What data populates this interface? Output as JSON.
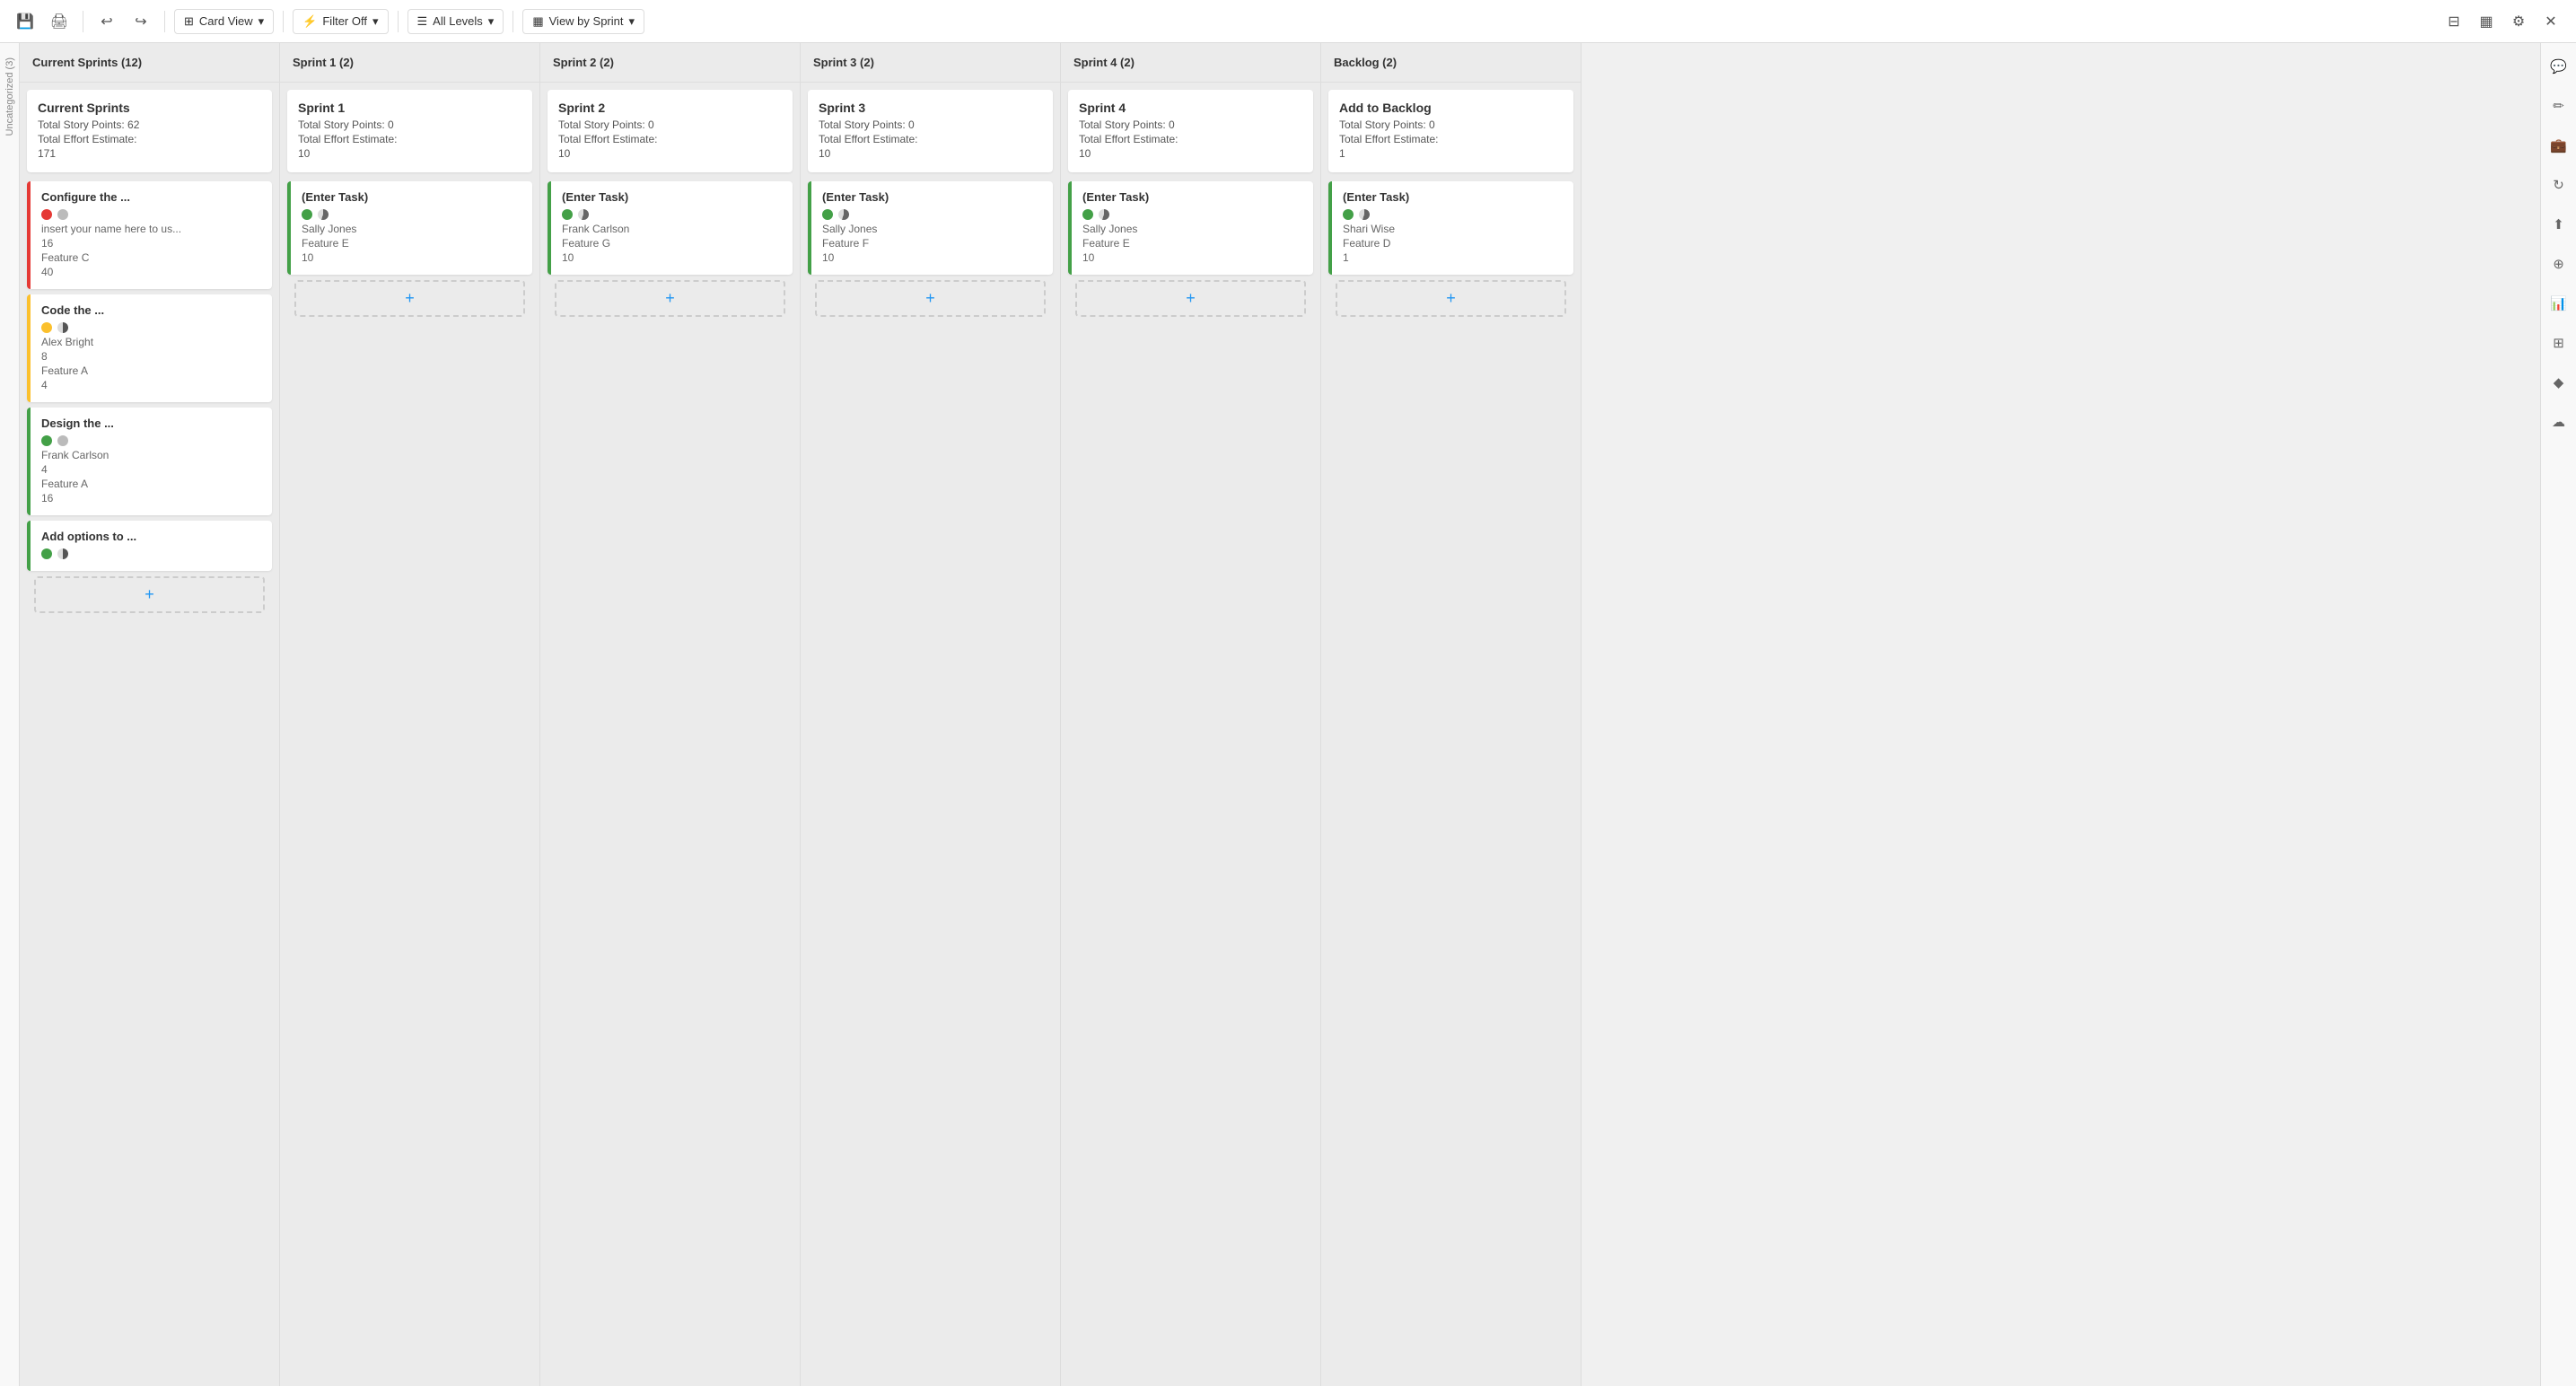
{
  "toolbar": {
    "save_icon": "💾",
    "print_icon": "🖨",
    "undo_icon": "↩",
    "redo_icon": "↪",
    "card_view_label": "Card View",
    "filter_label": "Filter Off",
    "levels_label": "All Levels",
    "view_by_sprint_label": "View by Sprint",
    "grid_icon": "▦"
  },
  "left_sidebar": {
    "label": "Uncategorized (3)"
  },
  "columns": [
    {
      "id": "current-sprints",
      "header": "Current Sprints (12)",
      "summary": {
        "title": "Current Sprints",
        "story_points_label": "Total Story Points: 62",
        "effort_label": "Total Effort Estimate:",
        "effort_value": "171"
      },
      "cards": [
        {
          "title": "Configure the ...",
          "border": "red",
          "dot_color": "red",
          "dot2_color": "gray",
          "assignee": "insert your name here to us...",
          "points": "16",
          "feature": "Feature C",
          "effort": "40"
        },
        {
          "title": "Code the ...",
          "border": "yellow",
          "dot_color": "yellow",
          "dot2_color": "half",
          "assignee": "Alex Bright",
          "points": "8",
          "feature": "Feature A",
          "effort": "4"
        },
        {
          "title": "Design the ...",
          "border": "green",
          "dot_color": "green",
          "dot2_color": "gray",
          "assignee": "Frank Carlson",
          "points": "4",
          "feature": "Feature A",
          "effort": "16"
        },
        {
          "title": "Add options to ...",
          "border": "green",
          "dot_color": "green",
          "dot2_color": "half",
          "assignee": "",
          "points": "",
          "feature": "",
          "effort": ""
        }
      ]
    },
    {
      "id": "sprint-1",
      "header": "Sprint 1 (2)",
      "summary": {
        "title": "Sprint 1",
        "story_points_label": "Total Story Points: 0",
        "effort_label": "Total Effort Estimate:",
        "effort_value": "10"
      },
      "cards": [
        {
          "title": "(Enter Task)",
          "border": "green",
          "dot_color": "green",
          "dot2_color": "pie",
          "assignee": "Sally Jones",
          "feature": "Feature E",
          "effort": "10"
        }
      ]
    },
    {
      "id": "sprint-2",
      "header": "Sprint 2 (2)",
      "summary": {
        "title": "Sprint 2",
        "story_points_label": "Total Story Points: 0",
        "effort_label": "Total Effort Estimate:",
        "effort_value": "10"
      },
      "cards": [
        {
          "title": "(Enter Task)",
          "border": "green",
          "dot_color": "green",
          "dot2_color": "pie",
          "assignee": "Frank Carlson",
          "feature": "Feature G",
          "effort": "10"
        }
      ]
    },
    {
      "id": "sprint-3",
      "header": "Sprint 3 (2)",
      "summary": {
        "title": "Sprint 3",
        "story_points_label": "Total Story Points: 0",
        "effort_label": "Total Effort Estimate:",
        "effort_value": "10"
      },
      "cards": [
        {
          "title": "(Enter Task)",
          "border": "green",
          "dot_color": "green",
          "dot2_color": "pie",
          "assignee": "Sally Jones",
          "feature": "Feature F",
          "effort": "10"
        }
      ]
    },
    {
      "id": "sprint-4",
      "header": "Sprint 4 (2)",
      "summary": {
        "title": "Sprint 4",
        "story_points_label": "Total Story Points: 0",
        "effort_label": "Total Effort Estimate:",
        "effort_value": "10"
      },
      "cards": [
        {
          "title": "(Enter Task)",
          "border": "green",
          "dot_color": "green",
          "dot2_color": "pie",
          "assignee": "Sally Jones",
          "feature": "Feature E",
          "effort": "10"
        }
      ]
    },
    {
      "id": "backlog",
      "header": "Backlog (2)",
      "summary": {
        "title": "Add to Backlog",
        "story_points_label": "Total Story Points: 0",
        "effort_label": "Total Effort Estimate:",
        "effort_value": "1"
      },
      "cards": [
        {
          "title": "(Enter Task)",
          "border": "green",
          "dot_color": "green",
          "dot2_color": "pie",
          "assignee": "Shari Wise",
          "feature": "Feature D",
          "effort": "1"
        }
      ]
    }
  ],
  "right_sidebar_icons": [
    {
      "name": "comment-icon",
      "glyph": "💬"
    },
    {
      "name": "edit-icon",
      "glyph": "✏️"
    },
    {
      "name": "briefcase-icon",
      "glyph": "💼"
    },
    {
      "name": "refresh-icon",
      "glyph": "🔄"
    },
    {
      "name": "upload-icon",
      "glyph": "⬆"
    },
    {
      "name": "globe-icon",
      "glyph": "🌐"
    },
    {
      "name": "chart-icon",
      "glyph": "📊"
    },
    {
      "name": "grid-icon",
      "glyph": "⊞"
    },
    {
      "name": "diamond-icon",
      "glyph": "◆"
    },
    {
      "name": "cloud-icon",
      "glyph": "☁"
    }
  ]
}
